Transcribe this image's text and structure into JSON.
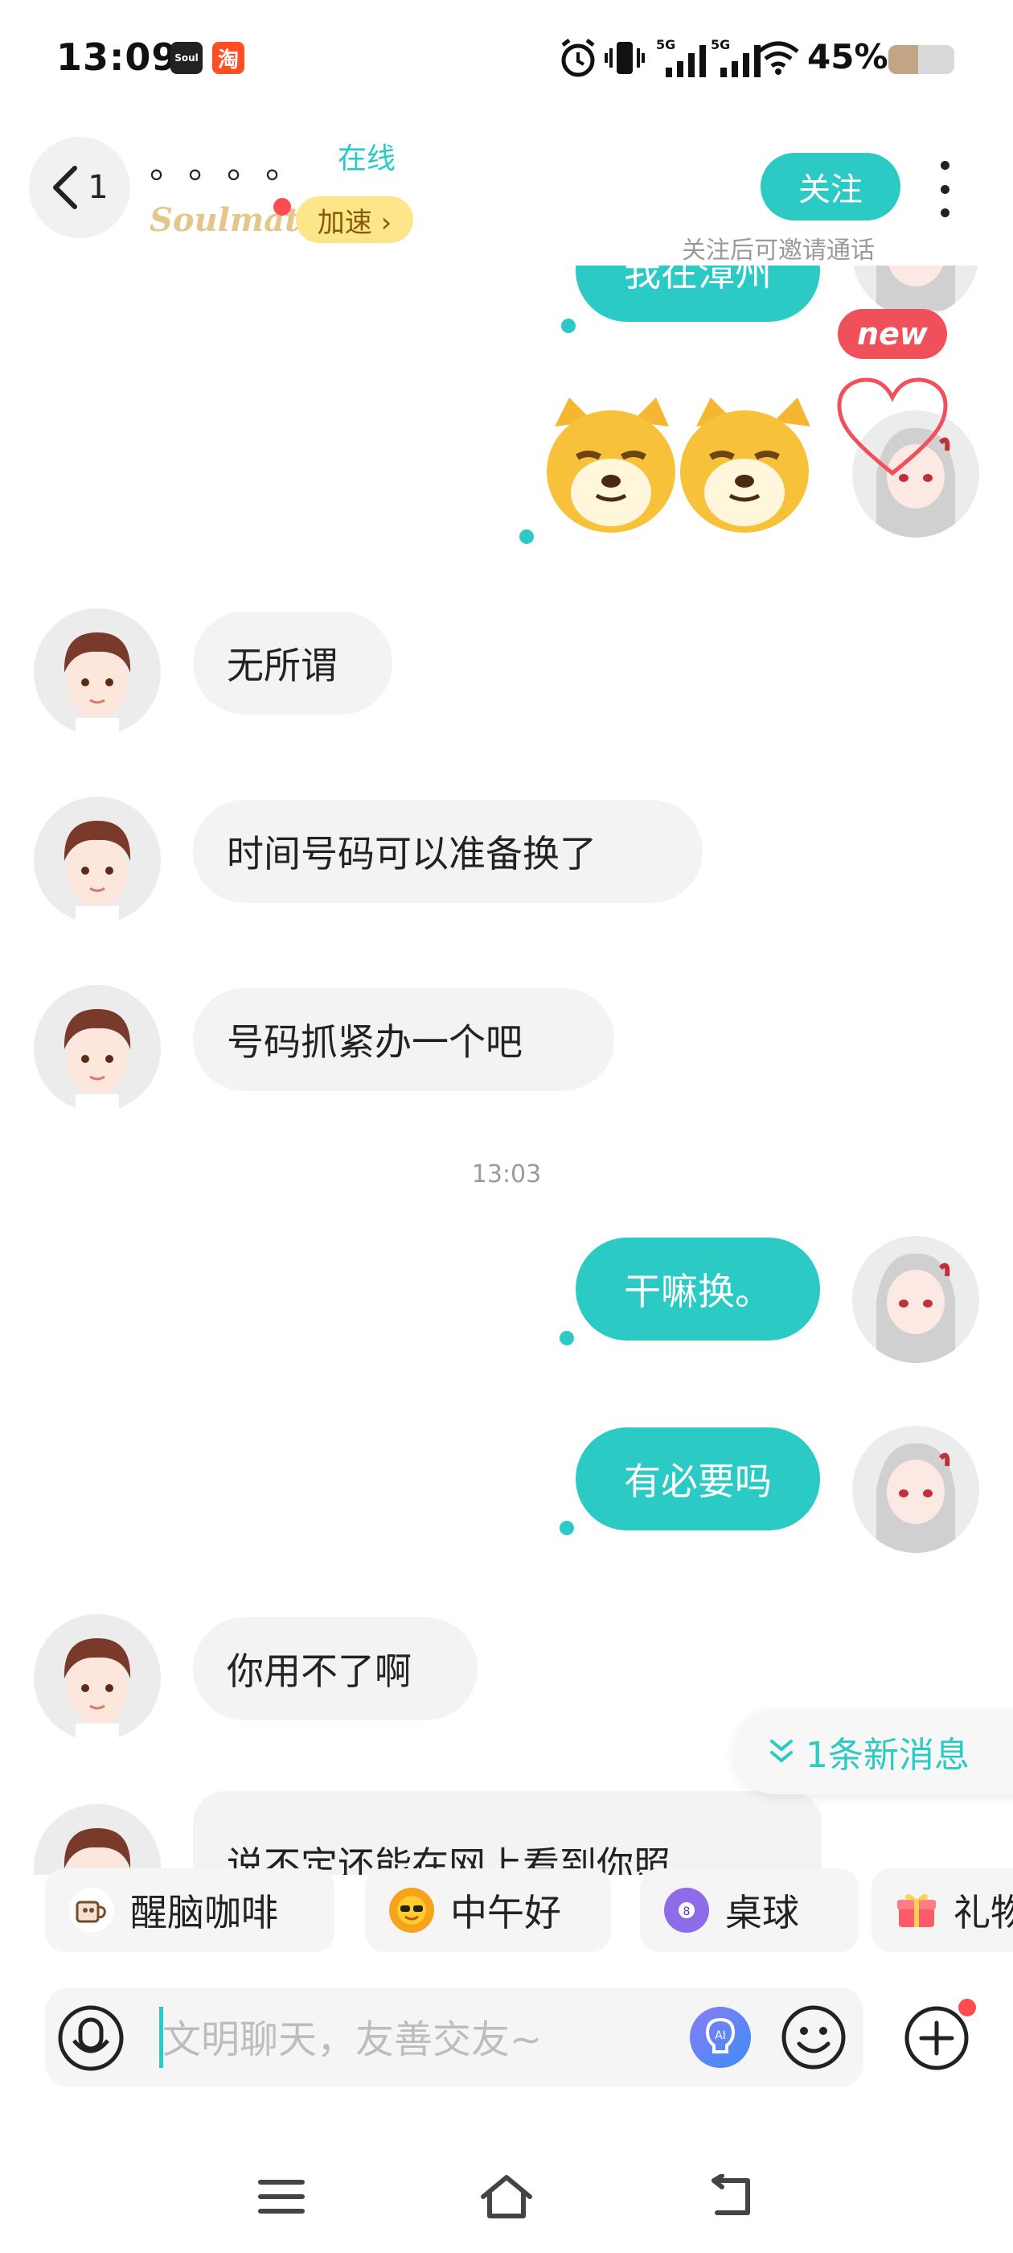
{
  "status_bar": {
    "time": "13:09",
    "app_icons": [
      {
        "name": "soul-app-icon",
        "text": "Soul",
        "color": "#222222"
      },
      {
        "name": "taobao-app-icon",
        "text": "淘",
        "color": "#ff4e20"
      }
    ],
    "network_labels": [
      "5G",
      "5G"
    ],
    "battery": "45%",
    "battery_level": 0.45
  },
  "header": {
    "back_count": "1",
    "contact_name": "。。。。",
    "online_status": "在线",
    "soulmate_label": "Soulmate",
    "speed_button": "加速 ›",
    "follow_button": "关注",
    "follow_hint": "关注后可邀请通话"
  },
  "messages": {
    "m1": "我在漳州",
    "new_badge": "new",
    "m3": "无所谓",
    "m4": "时间号码可以准备换了",
    "m5": "号码抓紧办一个吧",
    "timestamp": "13:03",
    "m6": "干嘛换。",
    "m7": "有必要吗",
    "m8": "你用不了啊",
    "m9": "说不定还能在网上看到你照"
  },
  "new_messages_pill": "1条新消息",
  "quick_chips": [
    {
      "label": "醒脑咖啡",
      "icon": "coffee-icon"
    },
    {
      "label": "中午好",
      "icon": "sun-sunglasses-icon"
    },
    {
      "label": "桌球",
      "icon": "billiard-ball-icon"
    },
    {
      "label": "礼物",
      "icon": "gift-icon"
    }
  ],
  "input": {
    "placeholder": "文明聊天，友善交友~"
  },
  "colors": {
    "accent": "#2ccac4",
    "badge_red": "#f0505a",
    "incoming_bubble": "#f3f3f3"
  }
}
